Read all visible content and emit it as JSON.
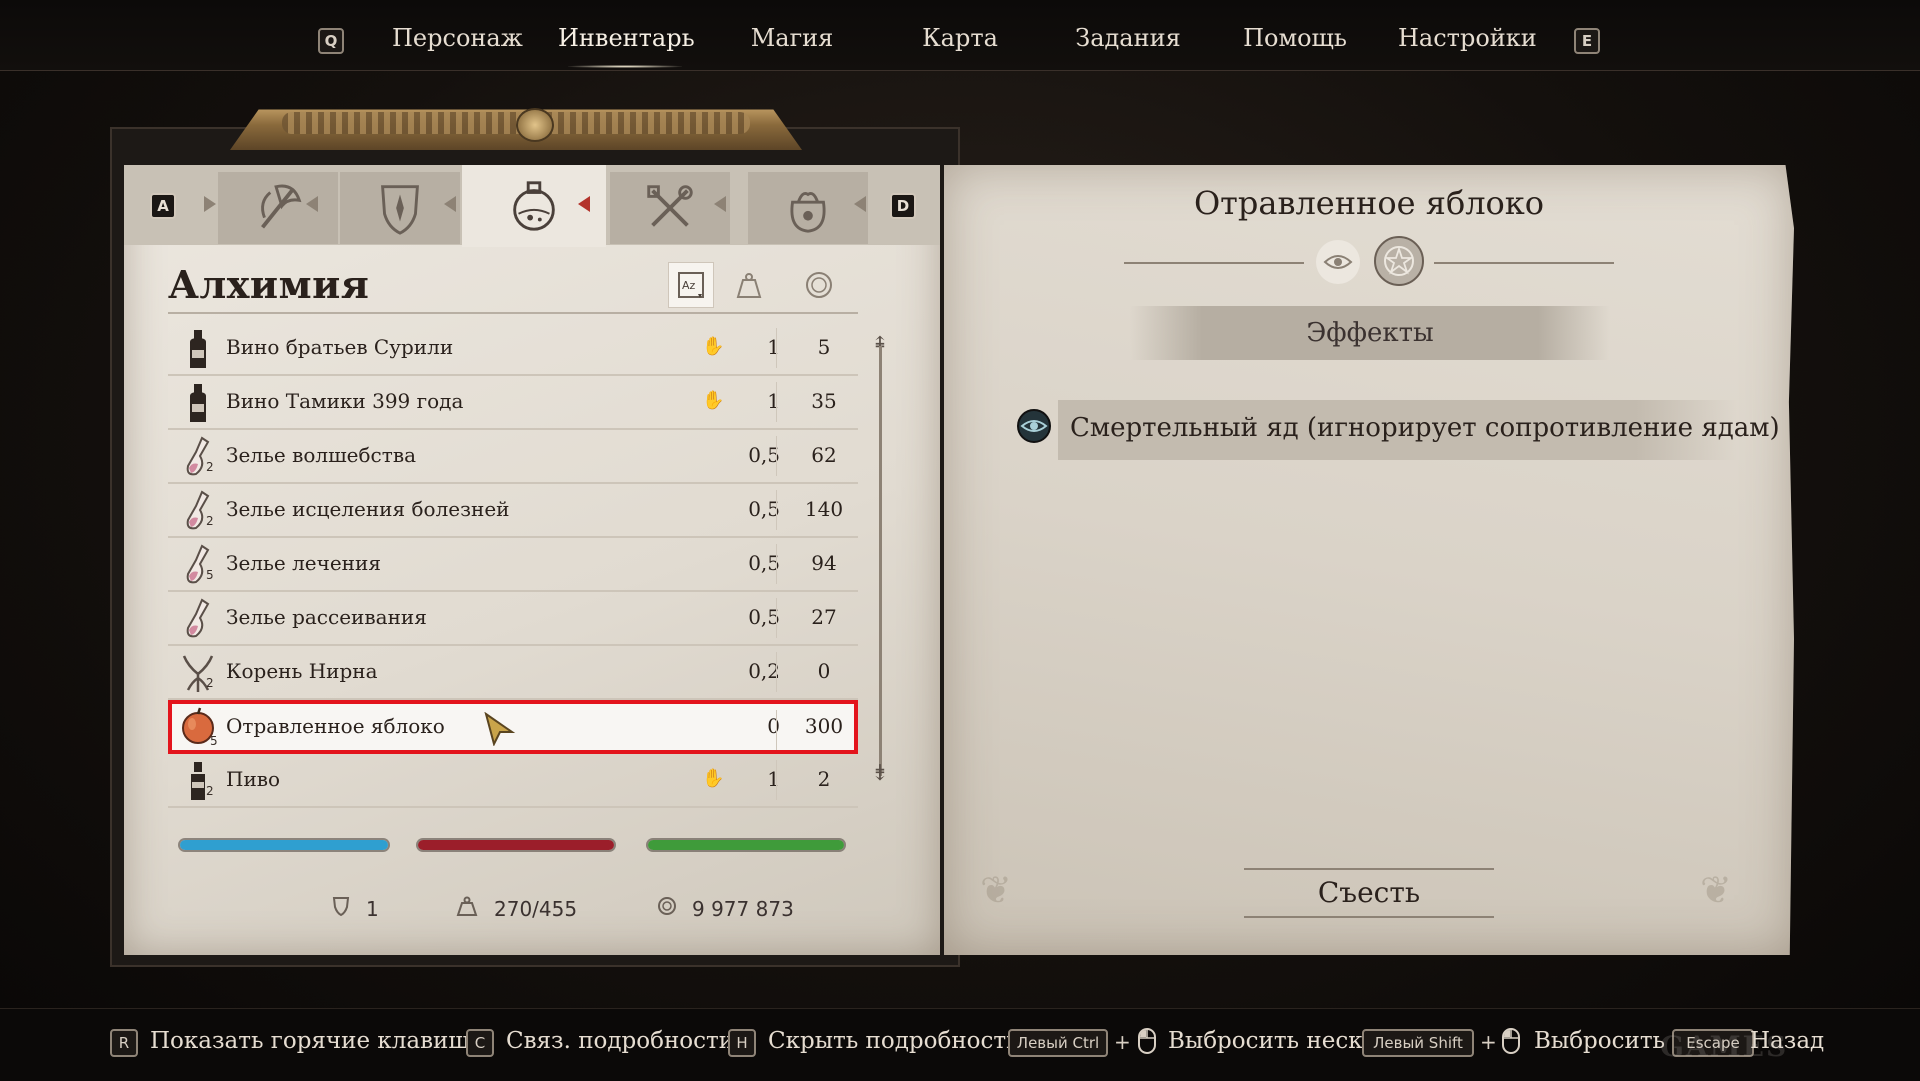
{
  "nav": {
    "key_left": "Q",
    "key_right": "E",
    "tabs": [
      "Персонаж",
      "Инвентарь",
      "Магия",
      "Карта",
      "Задания",
      "Помощь",
      "Настройки"
    ],
    "active_tab": "Инвентарь"
  },
  "inventory": {
    "key_prev": "A",
    "key_next": "D",
    "categories": [
      "weapons-axe-icon",
      "armor-shield-icon",
      "alchemy-flask-icon",
      "tools-icon",
      "misc-bag-icon"
    ],
    "active_category": "alchemy-flask-icon",
    "section_title": "Алхимия",
    "sort_icons": [
      "sort-az-icon",
      "weight-icon",
      "coin-icon"
    ],
    "items": [
      {
        "name": "Вино братьев Сурили",
        "qty": "",
        "icon": "wine-bottle-icon",
        "stolen": true,
        "weight": "1",
        "price": "5"
      },
      {
        "name": "Вино Тамики 399 года",
        "qty": "",
        "icon": "wine-bottle-icon",
        "stolen": true,
        "weight": "1",
        "price": "35"
      },
      {
        "name": "Зелье волшебства",
        "qty": "2",
        "icon": "potion-icon",
        "stolen": false,
        "weight": "0,5",
        "price": "62"
      },
      {
        "name": "Зелье исцеления болезней",
        "qty": "2",
        "icon": "potion-icon",
        "stolen": false,
        "weight": "0,5",
        "price": "140"
      },
      {
        "name": "Зелье лечения",
        "qty": "5",
        "icon": "potion-icon",
        "stolen": false,
        "weight": "0,5",
        "price": "94"
      },
      {
        "name": "Зелье рассеивания",
        "qty": "",
        "icon": "potion-icon",
        "stolen": false,
        "weight": "0,5",
        "price": "27"
      },
      {
        "name": "Корень Нирна",
        "qty": "2",
        "icon": "root-icon",
        "stolen": false,
        "weight": "0,2",
        "price": "0"
      },
      {
        "name": "Отравленное яблоко",
        "qty": "5",
        "icon": "apple-icon",
        "stolen": false,
        "weight": "0",
        "price": "300",
        "selected": true
      },
      {
        "name": "Пиво",
        "qty": "2",
        "icon": "beer-bottle-icon",
        "stolen": true,
        "weight": "1",
        "price": "2"
      }
    ],
    "bars": {
      "health_color": "#2f9fd0",
      "magicka_color": "#9b1e2a",
      "stamina_color": "#3f9b3a"
    },
    "footer": {
      "armor": "1",
      "weight": "270/455",
      "gold": "9 977 873"
    }
  },
  "detail": {
    "title": "Отравленное яблоко",
    "effects_label": "Эффекты",
    "effect_icon": "poison-eye-icon",
    "effect": "Смертельный яд (игнорирует сопротивление ядам)",
    "action": "Съесть"
  },
  "hints": [
    {
      "key": "R",
      "text": "Показать горячие клавиши"
    },
    {
      "key": "C",
      "text": "Связ. подробности"
    },
    {
      "key": "H",
      "text": "Скрыть подробности"
    },
    {
      "key": "Левый Ctrl",
      "text": "Выбросить неск."
    },
    {
      "key": "Левый Shift",
      "text": "Выбросить"
    },
    {
      "key": "Escape",
      "text": "Назад"
    }
  ],
  "watermark": "GAMES"
}
